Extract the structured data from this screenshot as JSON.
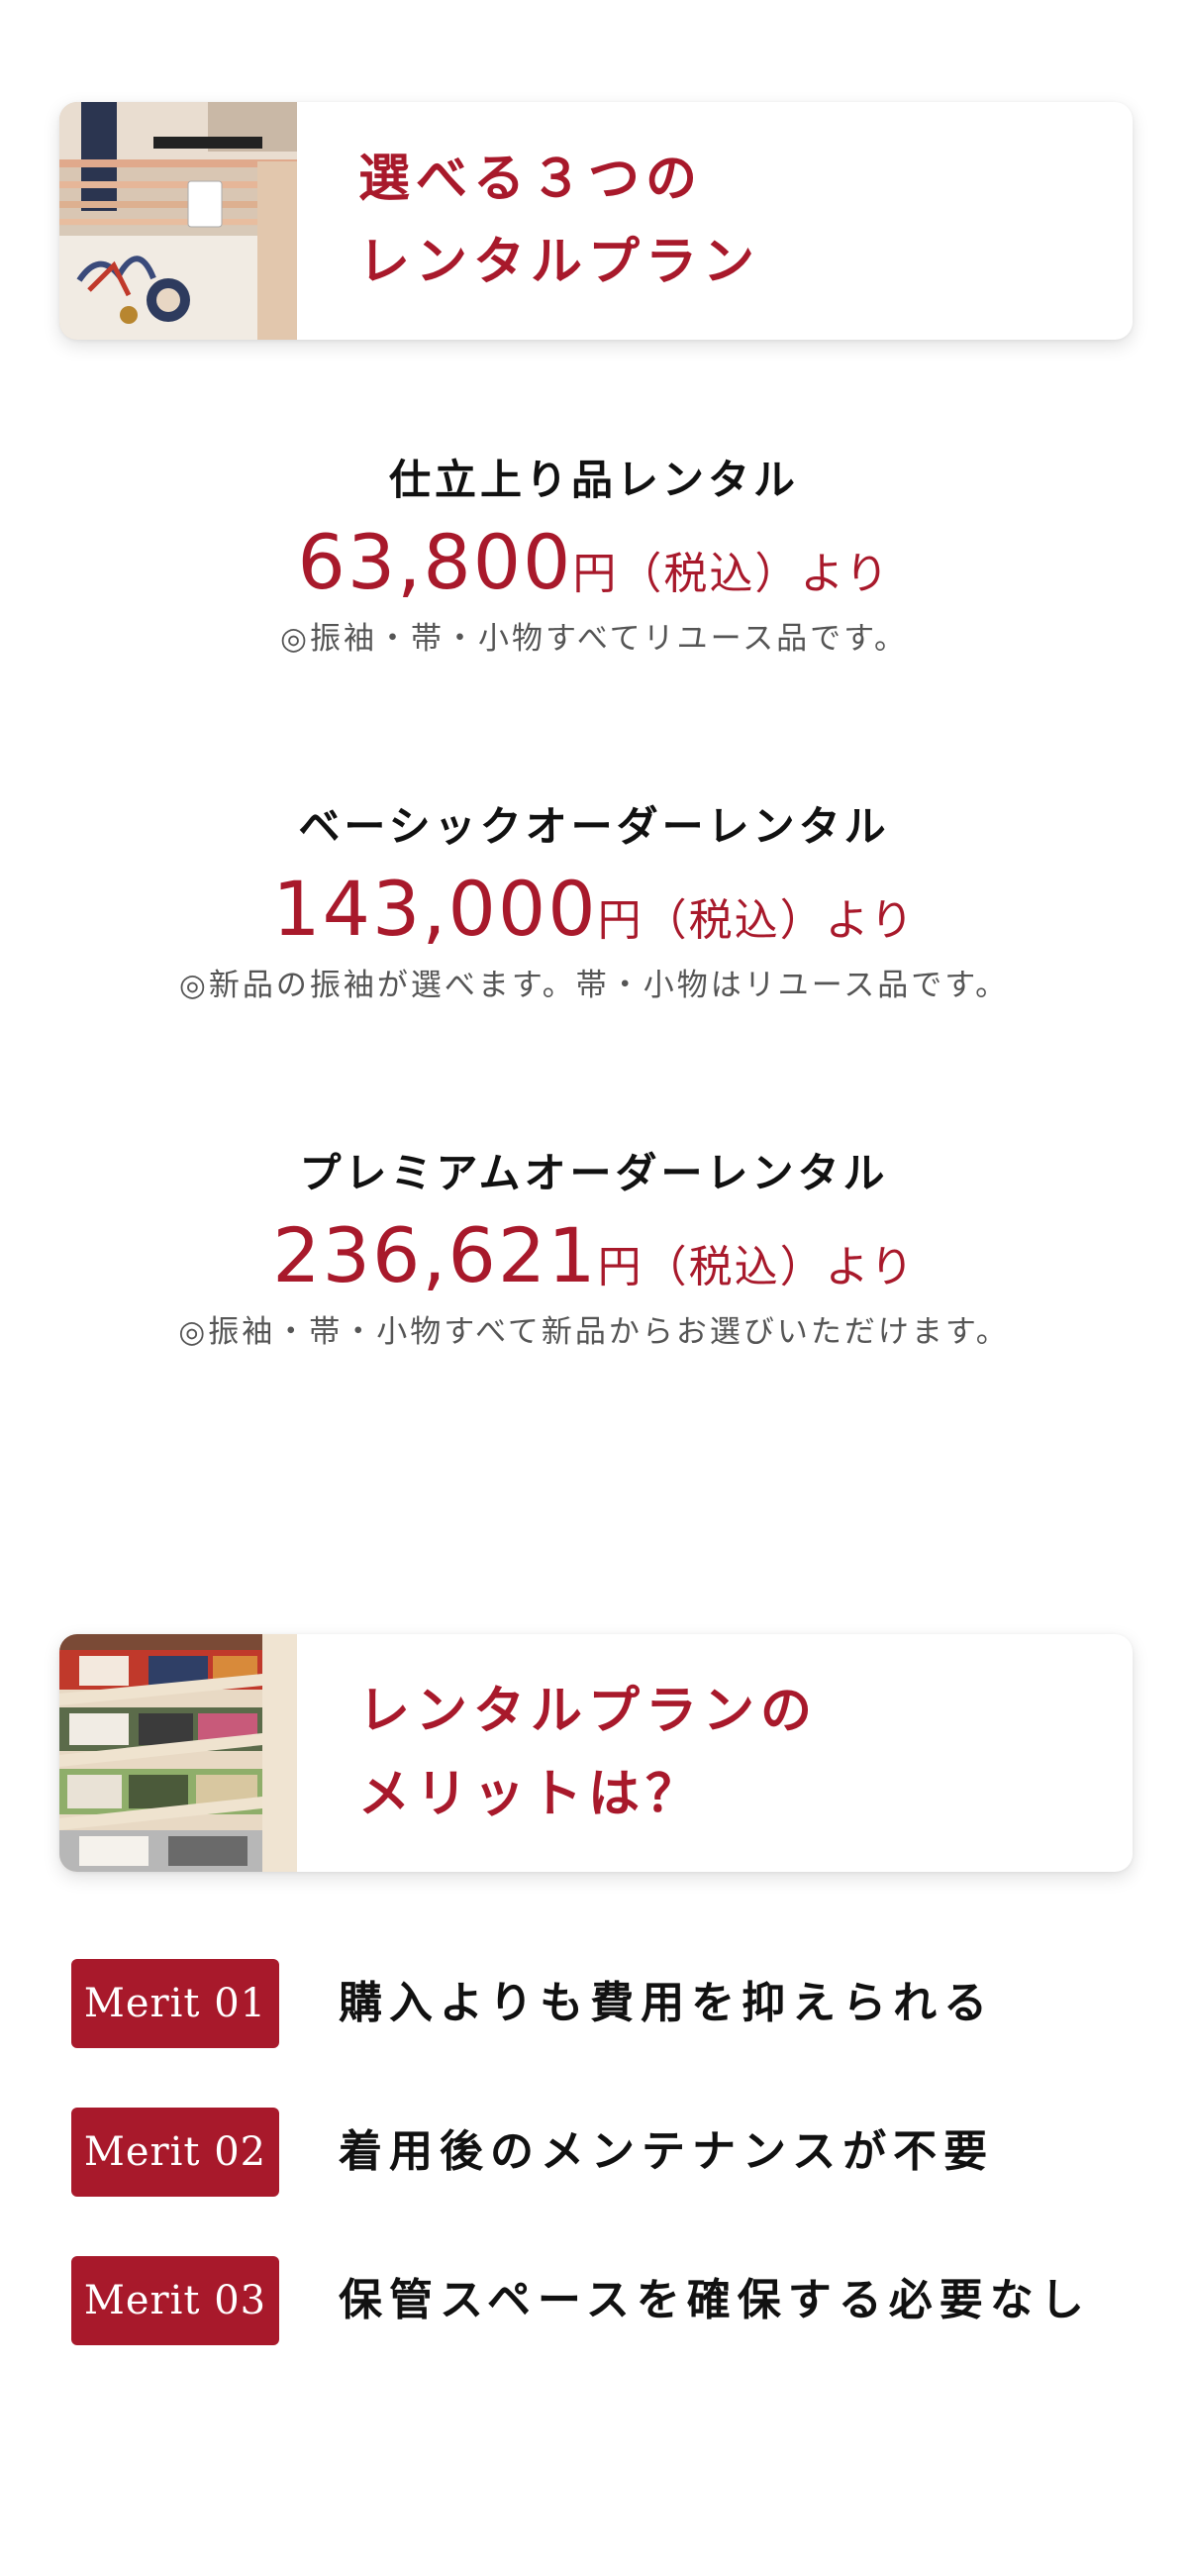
{
  "sections": {
    "plans": {
      "title_line1": "選べる３つの",
      "title_line2": "レンタルプラン"
    },
    "merits": {
      "title_line1": "レンタルプランの",
      "title_line2": "メリットは？"
    }
  },
  "plans": [
    {
      "name": "仕立上り品レンタル",
      "price": "63,800",
      "price_suffix": "円（税込）より",
      "note": "◎振袖・帯・小物すべてリユース品です。"
    },
    {
      "name": "ベーシックオーダーレンタル",
      "price": "143,000",
      "price_suffix": "円（税込）より",
      "note": "◎新品の振袖が選べます。帯・小物はリユース品です。"
    },
    {
      "name": "プレミアムオーダーレンタル",
      "price": "236,621",
      "price_suffix": "円（税込）より",
      "note": "◎振袖・帯・小物すべて新品からお選びいただけます。"
    }
  ],
  "merits": [
    {
      "badge": "Merit 01",
      "text": "購入よりも費用を抑えられる"
    },
    {
      "badge": "Merit 02",
      "text": "着用後のメンテナンスが不要"
    },
    {
      "badge": "Merit 03",
      "text": "保管スペースを確保する必要なし"
    }
  ],
  "colors": {
    "accent": "#a8192b",
    "text": "#111111",
    "note": "#555555",
    "background": "#ffffff"
  }
}
